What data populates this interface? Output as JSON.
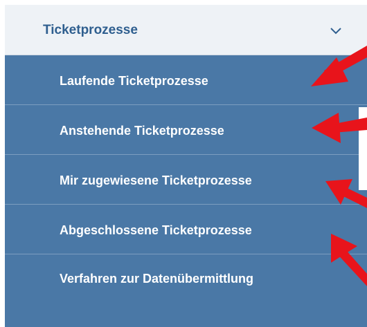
{
  "menu": {
    "title": "Ticketprozesse",
    "chevron_icon": "chevron-down-icon",
    "items": [
      {
        "label": "Laufende Ticketprozesse"
      },
      {
        "label": "Anstehende Ticketprozesse"
      },
      {
        "label": "Mir zugewiesene Ticketprozesse"
      },
      {
        "label": "Abgeschlossene Ticketprozesse"
      },
      {
        "label": "Verfahren zur Datenübermittlung"
      }
    ]
  },
  "colors": {
    "header_bg": "#eef2f6",
    "header_text": "#2f5f8f",
    "submenu_bg": "#4a78a6",
    "submenu_divider": "#7d9ec0",
    "arrow": "#e8141b"
  },
  "annotations": {
    "arrow_icon": "red-arrow-icon",
    "count": 5
  }
}
